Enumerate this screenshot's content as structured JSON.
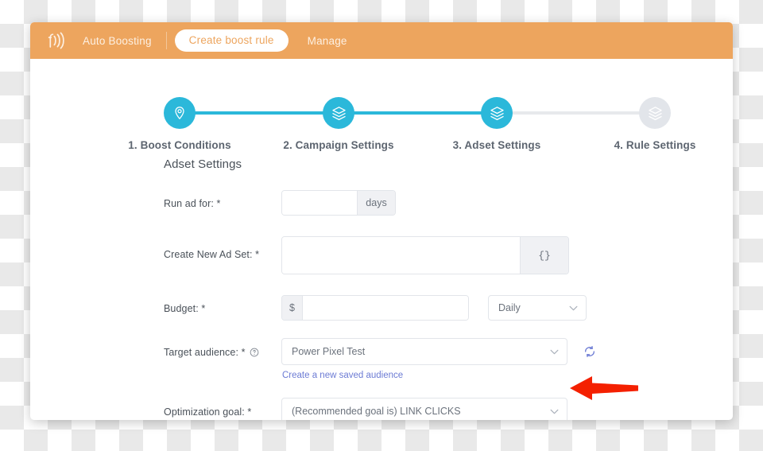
{
  "header": {
    "logo_icon": "broadcast-f-icon",
    "brand_color": "#eda55e",
    "nav": {
      "auto_boosting": "Auto Boosting",
      "create_boost_rule": "Create boost rule",
      "manage": "Manage"
    }
  },
  "stepper": {
    "active_color": "#2bb8da",
    "inactive_color": "#e2e5ea",
    "steps": [
      {
        "label": "1. Boost Conditions",
        "icon": "map-pin-icon",
        "active": true
      },
      {
        "label": "2. Campaign Settings",
        "icon": "layers-icon",
        "active": true
      },
      {
        "label": "3. Adset Settings",
        "icon": "layers-icon",
        "active": true
      },
      {
        "label": "4. Rule Settings",
        "icon": "layers-icon",
        "active": false
      }
    ]
  },
  "form": {
    "section_title": "Adset Settings",
    "run_ad_for": {
      "label": "Run ad for: *",
      "value": "",
      "placeholder": "",
      "unit_addon": "days"
    },
    "create_new_ad_set": {
      "label": "Create New Ad Set: *",
      "value": "",
      "placeholder": "",
      "token_button": "{}"
    },
    "budget": {
      "label": "Budget: *",
      "currency_addon": "$",
      "value": "",
      "placeholder": "",
      "schedule_selected": "Daily"
    },
    "target_audience": {
      "label": "Target audience: *",
      "help_icon": "question-circle-icon",
      "selected": "Power Pixel Test",
      "refresh_icon": "refresh-icon",
      "create_link": "Create a new saved audience"
    },
    "optimization_goal": {
      "label": "Optimization goal: *",
      "selected": "(Recommended goal is) LINK CLICKS"
    }
  },
  "annotation": {
    "arrow_color": "#f42000",
    "arrow_direction": "left",
    "points_at": "optimization-goal-select"
  }
}
